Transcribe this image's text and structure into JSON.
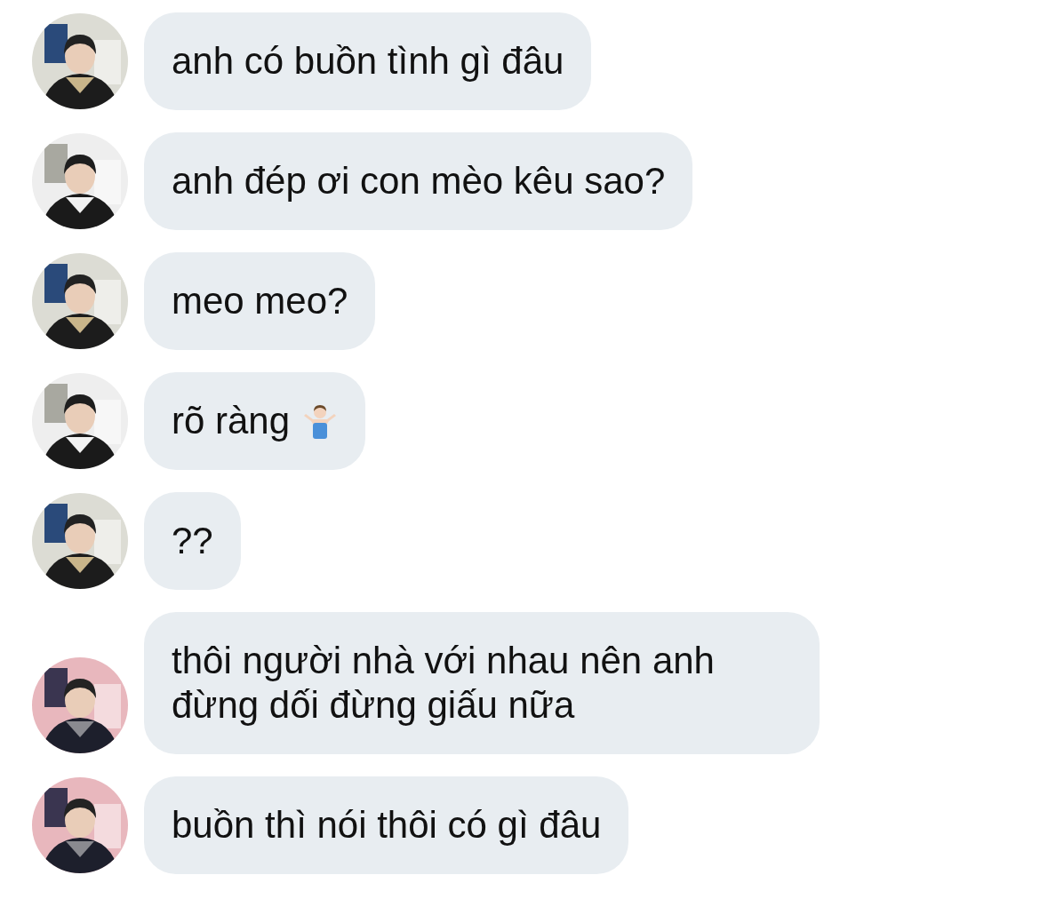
{
  "messages": [
    {
      "kind": "grey",
      "text": "anh có buồn tình gì đâu",
      "emoji": false
    },
    {
      "kind": "light",
      "text": "anh đép ơi con mèo kêu sao?",
      "emoji": false
    },
    {
      "kind": "grey",
      "text": "meo meo?",
      "emoji": false
    },
    {
      "kind": "light",
      "text": "rõ ràng",
      "emoji": true
    },
    {
      "kind": "grey",
      "text": "??",
      "emoji": false
    },
    {
      "kind": "pink",
      "text": "thôi người nhà với nhau nên anh đừng dối đừng giấu nữa",
      "emoji": false
    },
    {
      "kind": "pink",
      "text": "buồn thì nói thôi có gì đâu",
      "emoji": false
    }
  ]
}
